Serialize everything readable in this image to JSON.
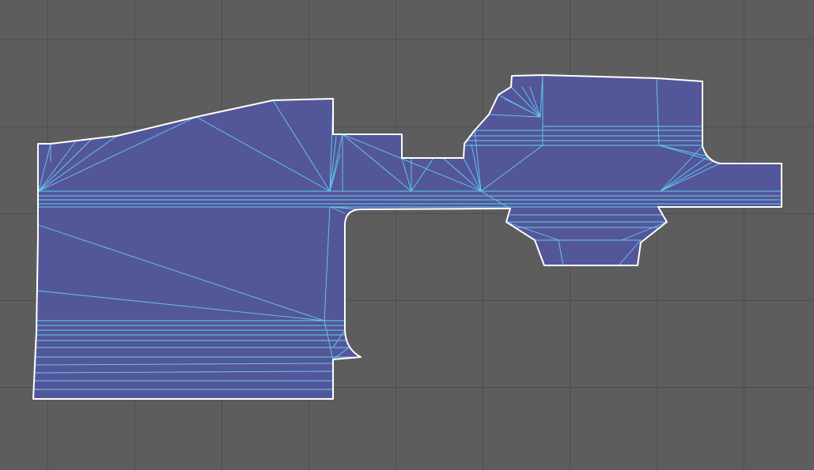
{
  "editor_view": {
    "name": "navmesh-viewport",
    "colors": {
      "background": "#5d5d5d",
      "grid_line": "#4e4e4e",
      "mesh_fill": "#54569a",
      "triangle_edge": "#63cdf0",
      "outline": "#ffffff"
    },
    "grid": {
      "visible": true
    }
  }
}
